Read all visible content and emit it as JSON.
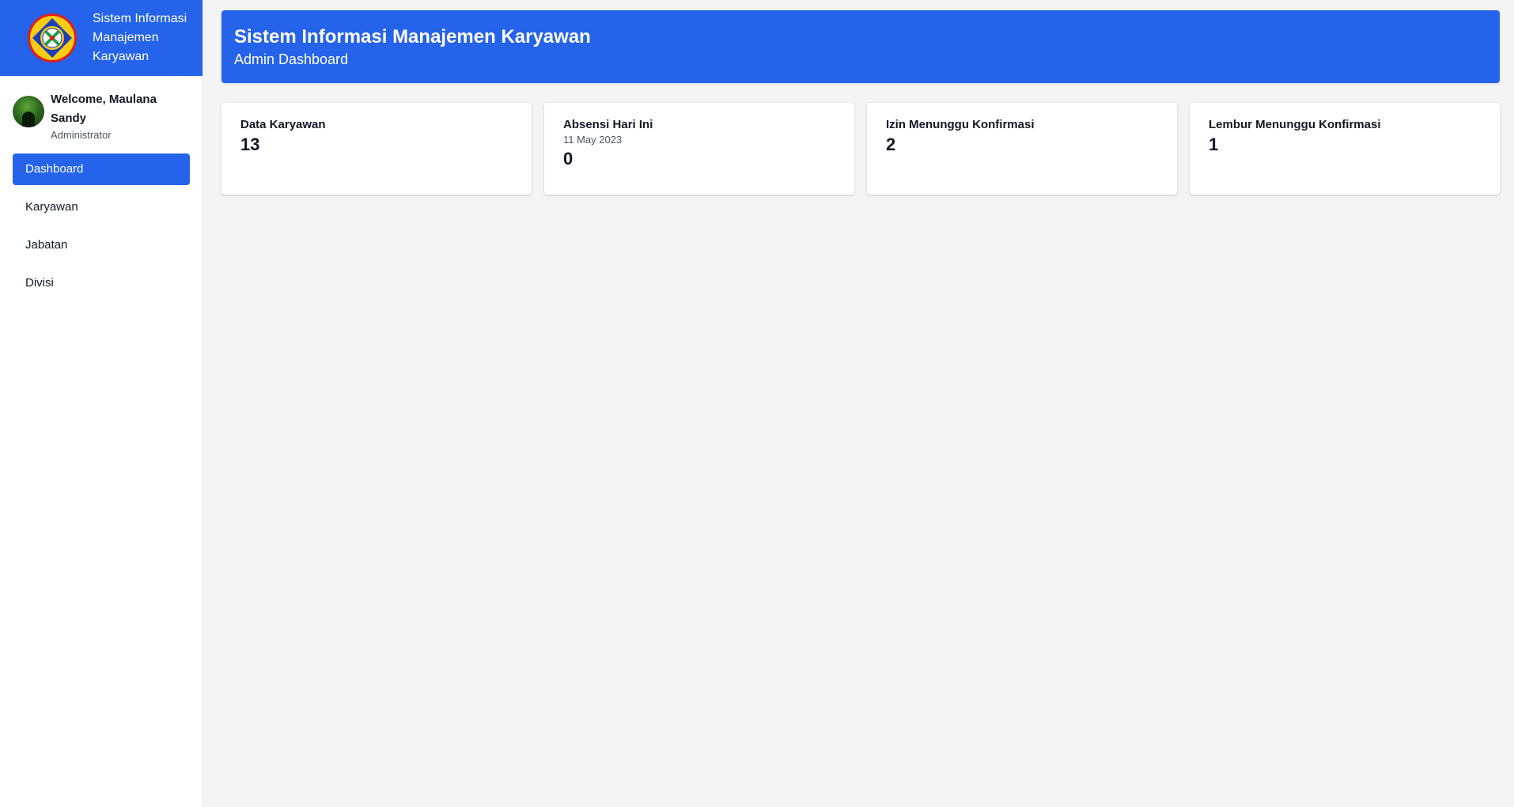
{
  "app": {
    "title": "Sistem Informasi Manajemen Karyawan"
  },
  "user": {
    "welcome": "Welcome, Maulana Sandy",
    "role": "Administrator"
  },
  "nav": {
    "items": [
      {
        "label": "Dashboard",
        "active": true
      },
      {
        "label": "Karyawan",
        "active": false
      },
      {
        "label": "Jabatan",
        "active": false
      },
      {
        "label": "Divisi",
        "active": false
      }
    ]
  },
  "header": {
    "title": "Sistem Informasi Manajemen Karyawan",
    "subtitle": "Admin Dashboard"
  },
  "cards": [
    {
      "title": "Data Karyawan",
      "sub": "",
      "value": "13"
    },
    {
      "title": "Absensi Hari Ini",
      "sub": "11 May 2023",
      "value": "0"
    },
    {
      "title": "Izin Menunggu Konfirmasi",
      "sub": "",
      "value": "2"
    },
    {
      "title": "Lembur Menunggu Konfirmasi",
      "sub": "",
      "value": "1"
    }
  ],
  "colors": {
    "accent": "#2563eb",
    "background": "#f3f4f6",
    "surface": "#ffffff"
  },
  "icons": {
    "logo": "logo-icon",
    "avatar": "avatar"
  }
}
